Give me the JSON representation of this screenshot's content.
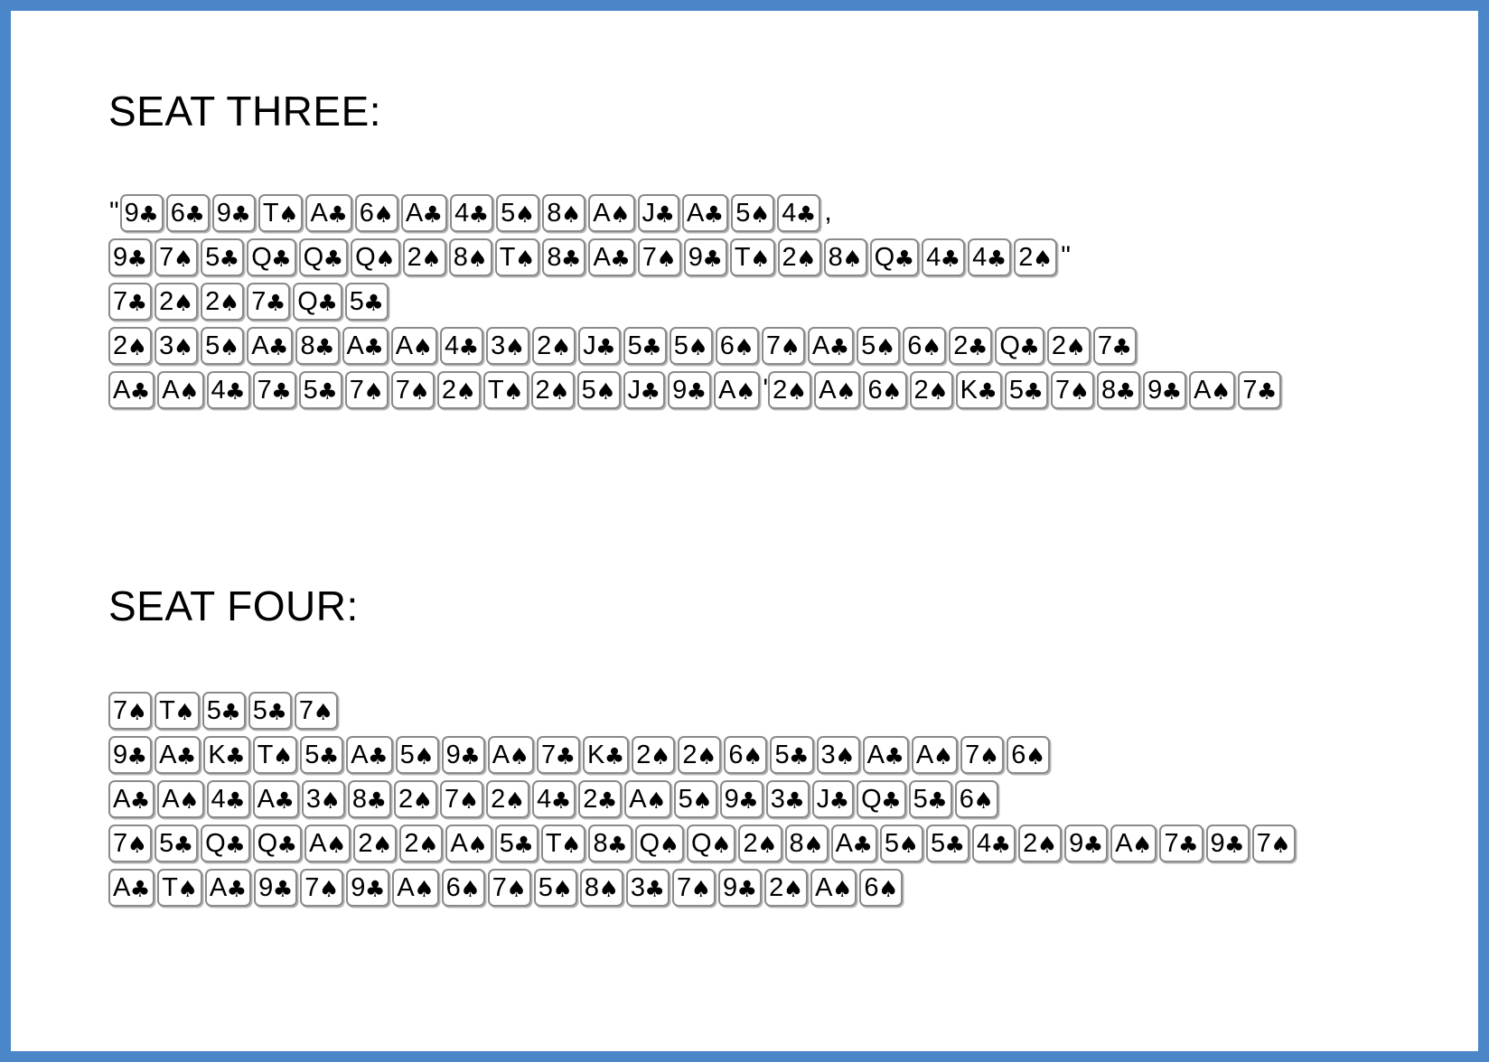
{
  "window": {
    "background_color": "#4a86c8",
    "page_color": "#ffffff"
  },
  "sections": [
    {
      "id": "seat-three",
      "title": "SEAT THREE:",
      "rows": [
        {
          "leading_punct": "\"",
          "trailing_punct": ",",
          "cards": [
            "9♣",
            "6♣",
            "9♣",
            "T♠",
            "A♣",
            "6♠",
            "A♣",
            "4♣",
            "5♠",
            "8♠",
            "A♠",
            "J♣",
            "A♣",
            "5♠",
            "4♣"
          ]
        },
        {
          "leading_punct": "",
          "trailing_punct": "\"",
          "cards": [
            "9♣",
            "7♠",
            "5♣",
            "Q♣",
            "Q♣",
            "Q♠",
            "2♠",
            "8♠",
            "T♠",
            "8♣",
            "A♣",
            "7♠",
            "9♣",
            "T♠",
            "2♠",
            "8♠",
            "Q♣",
            "4♣",
            "4♣",
            "2♠"
          ]
        },
        {
          "leading_punct": "",
          "trailing_punct": "",
          "cards": [
            "7♣",
            "2♠",
            "2♠",
            "7♣",
            "Q♣",
            "5♣"
          ]
        },
        {
          "leading_punct": "",
          "trailing_punct": "",
          "cards": [
            "2♠",
            "3♠",
            "5♠",
            "A♣",
            "8♣",
            "A♣",
            "A♠",
            "4♣",
            "3♠",
            "2♠",
            "J♣",
            "5♣",
            "5♠",
            "6♠",
            "7♠",
            "A♣",
            "5♠",
            "6♠",
            "2♣",
            "Q♣",
            "2♠",
            "7♣"
          ]
        },
        {
          "leading_punct": "",
          "trailing_punct": "",
          "cards": [
            "A♣",
            "A♠",
            "4♣",
            "7♣",
            "5♣",
            "7♠",
            "7♠",
            "2♠",
            "T♠",
            "2♠",
            "5♠",
            "J♣",
            "9♣",
            "A♠",
            "'2♠",
            "A♠",
            "6♠",
            "2♠",
            "K♣",
            "5♣",
            "7♠",
            "8♣",
            "9♣",
            "A♠",
            "7♣"
          ]
        }
      ]
    },
    {
      "id": "seat-four",
      "title": "SEAT FOUR:",
      "rows": [
        {
          "leading_punct": "",
          "trailing_punct": "",
          "cards": [
            "7♠",
            "T♠",
            "5♣",
            "5♣",
            "7♠"
          ]
        },
        {
          "leading_punct": "",
          "trailing_punct": "",
          "cards": [
            "9♣",
            "A♣",
            "K♣",
            "T♠",
            "5♣",
            "A♣",
            "5♠",
            "9♣",
            "A♠",
            "7♣",
            "K♣",
            "2♠",
            "2♠",
            "6♠",
            "5♣",
            "3♠",
            "A♣",
            "A♠",
            "7♠",
            "6♠"
          ]
        },
        {
          "leading_punct": "",
          "trailing_punct": "",
          "cards": [
            "A♣",
            "A♠",
            "4♣",
            "A♣",
            "3♠",
            "8♣",
            "2♠",
            "7♠",
            "2♠",
            "4♣",
            "2♣",
            "A♠",
            "5♠",
            "9♣",
            "3♣",
            "J♣",
            "Q♣",
            "5♣",
            "6♠"
          ]
        },
        {
          "leading_punct": "",
          "trailing_punct": "",
          "cards": [
            "7♠",
            "5♣",
            "Q♣",
            "Q♣",
            "A♠",
            "2♠",
            "2♠",
            "A♠",
            "5♣",
            "T♠",
            "8♣",
            "Q♠",
            "Q♠",
            "2♠",
            "8♠",
            "A♣",
            "5♠",
            "5♣",
            "4♣",
            "2♠",
            "9♣",
            "A♠",
            "7♣",
            "9♣",
            "7♠"
          ]
        },
        {
          "leading_punct": "",
          "trailing_punct": "",
          "cards": [
            "A♣",
            "T♠",
            "A♣",
            "9♣",
            "7♠",
            "9♣",
            "A♠",
            "6♠",
            "7♠",
            "5♠",
            "8♠",
            "3♣",
            "7♠",
            "9♣",
            "2♠",
            "A♠",
            "6♠"
          ]
        }
      ]
    }
  ]
}
